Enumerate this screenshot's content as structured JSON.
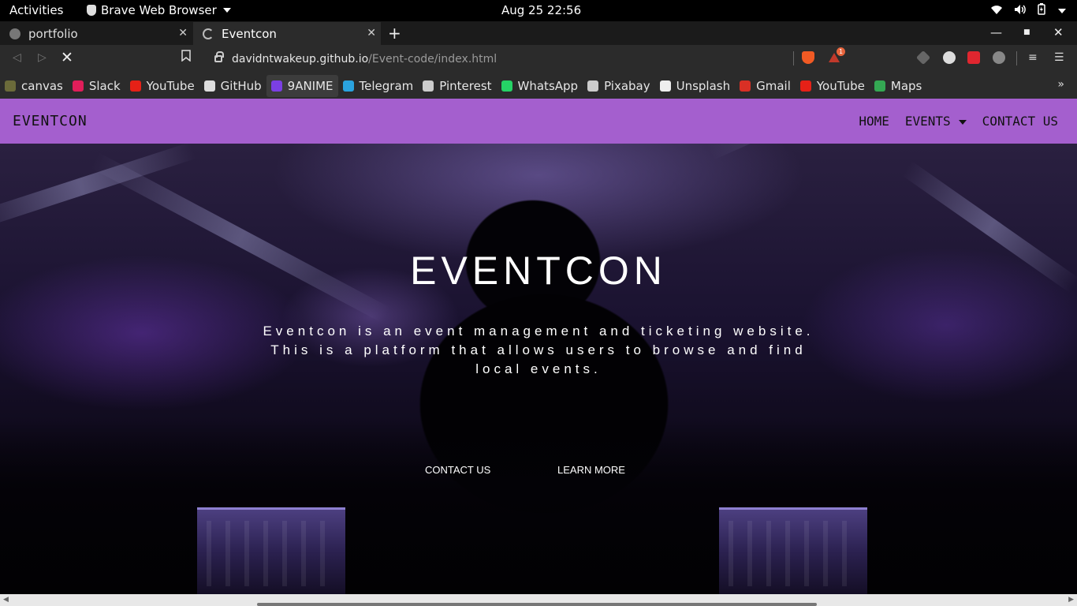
{
  "system": {
    "activities": "Activities",
    "app_name": "Brave Web Browser",
    "clock": "Aug 25  22:56"
  },
  "tabs": [
    {
      "title": "portfolio",
      "active": false
    },
    {
      "title": "Eventcon",
      "active": true
    }
  ],
  "address_bar": {
    "host": "davidntwakeup.github.io",
    "path": "/Event-code/index.html"
  },
  "extensions_badge": "1",
  "bookmarks": [
    {
      "label": "canvas",
      "icon": "canvas-icon",
      "color": "#6b6b3a"
    },
    {
      "label": "Slack",
      "icon": "slack-icon",
      "color": "#e01e5a"
    },
    {
      "label": "YouTube",
      "icon": "youtube-icon",
      "color": "#e62117"
    },
    {
      "label": "GitHub",
      "icon": "github-icon",
      "color": "#dddddd"
    },
    {
      "label": "9ANIME",
      "icon": "play-icon",
      "color": "#7b3fe4"
    },
    {
      "label": "Telegram",
      "icon": "telegram-icon",
      "color": "#2aa3df"
    },
    {
      "label": "Pinterest",
      "icon": "globe-icon",
      "color": "#cccccc"
    },
    {
      "label": "WhatsApp",
      "icon": "whatsapp-icon",
      "color": "#25d366"
    },
    {
      "label": "Pixabay",
      "icon": "globe-icon",
      "color": "#cccccc"
    },
    {
      "label": "Unsplash",
      "icon": "unsplash-icon",
      "color": "#eeeeee"
    },
    {
      "label": "Gmail",
      "icon": "gmail-icon",
      "color": "#d93025"
    },
    {
      "label": "YouTube",
      "icon": "youtube-icon",
      "color": "#e62117"
    },
    {
      "label": "Maps",
      "icon": "maps-icon",
      "color": "#34a853"
    }
  ],
  "site": {
    "brand": "EVENTCON",
    "nav": {
      "home": "HOME",
      "events": "EVENTS",
      "contact": "CONTACT US"
    },
    "hero": {
      "title": "EVENTCON",
      "text": "Eventcon is an event management and ticketing website. This is a platform that allows users to browse and find local events.",
      "contact_button": "CONTACT US",
      "learn_button": "LEARN MORE"
    },
    "nav_color": "#a45fce"
  }
}
